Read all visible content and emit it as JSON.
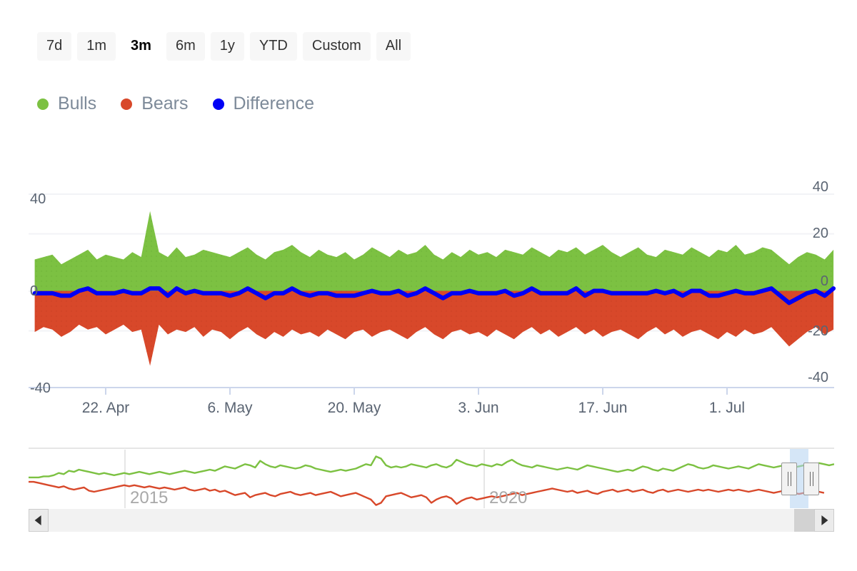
{
  "range_selector": {
    "buttons": [
      {
        "label": "7d",
        "selected": false
      },
      {
        "label": "1m",
        "selected": false
      },
      {
        "label": "3m",
        "selected": true
      },
      {
        "label": "6m",
        "selected": false
      },
      {
        "label": "1y",
        "selected": false
      },
      {
        "label": "YTD",
        "selected": false
      },
      {
        "label": "Custom",
        "selected": false
      },
      {
        "label": "All",
        "selected": false
      }
    ]
  },
  "legend": {
    "items": [
      {
        "label": "Bulls",
        "color": "#7cc142"
      },
      {
        "label": "Bears",
        "color": "#d8482a"
      },
      {
        "label": "Difference",
        "color": "#0000f5"
      }
    ]
  },
  "chart_data": {
    "type": "area",
    "title": "",
    "xlabel": "",
    "ylabel": "",
    "ylim": [
      -40,
      40
    ],
    "grid": true,
    "legend_position": "top-left",
    "y_ticks_left": [
      "40",
      "0",
      "-40"
    ],
    "y_ticks_right": [
      "40",
      "20",
      "0",
      "-20",
      "-40"
    ],
    "x_tick_labels": [
      "22. Apr",
      "6. May",
      "20. May",
      "3. Jun",
      "17. Jun",
      "1. Jul"
    ],
    "colors": {
      "bulls": "#7cc142",
      "bears": "#d8482a",
      "difference": "#0000f5",
      "gridline": "#f2f3f6",
      "axis": "#ccd6eb"
    },
    "series": [
      {
        "name": "Bulls",
        "type": "area",
        "values": [
          13,
          14,
          15,
          11,
          13,
          15,
          17,
          13,
          15,
          14,
          13,
          16,
          14,
          33,
          16,
          14,
          18,
          14,
          15,
          17,
          16,
          15,
          14,
          16,
          18,
          15,
          13,
          16,
          17,
          19,
          16,
          14,
          17,
          15,
          14,
          16,
          13,
          15,
          18,
          16,
          14,
          17,
          15,
          16,
          19,
          15,
          13,
          16,
          14,
          17,
          15,
          16,
          14,
          17,
          16,
          15,
          18,
          16,
          14,
          17,
          16,
          18,
          15,
          17,
          19,
          16,
          14,
          16,
          18,
          15,
          14,
          17,
          16,
          15,
          18,
          16,
          14,
          17,
          16,
          19,
          15,
          16,
          18,
          17,
          14,
          11,
          14,
          16,
          15,
          13,
          17
        ]
      },
      {
        "name": "Bears",
        "type": "area",
        "values": [
          -17,
          -15,
          -16,
          -19,
          -17,
          -14,
          -16,
          -15,
          -18,
          -16,
          -14,
          -17,
          -16,
          -31,
          -14,
          -18,
          -16,
          -17,
          -15,
          -19,
          -16,
          -17,
          -20,
          -17,
          -15,
          -18,
          -20,
          -17,
          -19,
          -16,
          -18,
          -17,
          -19,
          -16,
          -18,
          -20,
          -17,
          -16,
          -19,
          -17,
          -16,
          -18,
          -20,
          -17,
          -15,
          -18,
          -20,
          -17,
          -16,
          -18,
          -17,
          -19,
          -16,
          -18,
          -20,
          -17,
          -15,
          -18,
          -16,
          -19,
          -17,
          -15,
          -18,
          -16,
          -19,
          -17,
          -16,
          -18,
          -20,
          -17,
          -15,
          -18,
          -16,
          -19,
          -17,
          -16,
          -18,
          -20,
          -17,
          -19,
          -16,
          -18,
          -17,
          -15,
          -19,
          -23,
          -20,
          -17,
          -15,
          -18,
          -16
        ]
      },
      {
        "name": "Difference",
        "type": "line",
        "values": [
          -1,
          -1,
          -1,
          -2,
          -2,
          0,
          1,
          -1,
          -1,
          -1,
          0,
          -1,
          -1,
          1,
          1,
          -2,
          1,
          -1,
          0,
          -1,
          -1,
          -1,
          -2,
          -1,
          1,
          -1,
          -3,
          -1,
          -1,
          1,
          -1,
          -2,
          -1,
          -1,
          -2,
          -2,
          -2,
          -1,
          0,
          -1,
          -1,
          0,
          -2,
          -1,
          1,
          -1,
          -3,
          -1,
          -1,
          0,
          -1,
          -1,
          -1,
          0,
          -2,
          -1,
          1,
          -1,
          -1,
          -1,
          -1,
          1,
          -2,
          0,
          0,
          -1,
          -1,
          -1,
          -1,
          -1,
          0,
          -1,
          0,
          -2,
          0,
          0,
          -2,
          -2,
          -1,
          0,
          -1,
          -1,
          0,
          1,
          -2,
          -5,
          -3,
          -1,
          0,
          -2,
          1
        ]
      }
    ],
    "navigator": {
      "year_labels": [
        "2015",
        "2020"
      ],
      "selected_range_position": "far-right",
      "series": [
        {
          "name": "Bulls",
          "color": "#7cc142",
          "values": [
            2,
            2,
            2,
            3,
            3,
            4,
            6,
            5,
            8,
            7,
            9,
            8,
            7,
            6,
            5,
            6,
            5,
            4,
            5,
            6,
            5,
            6,
            7,
            6,
            5,
            6,
            7,
            6,
            5,
            6,
            7,
            8,
            7,
            6,
            7,
            8,
            9,
            8,
            10,
            12,
            11,
            10,
            12,
            14,
            13,
            11,
            17,
            14,
            12,
            11,
            13,
            12,
            11,
            10,
            11,
            13,
            12,
            10,
            9,
            8,
            7,
            8,
            9,
            8,
            9,
            10,
            12,
            14,
            13,
            21,
            19,
            13,
            11,
            12,
            11,
            12,
            14,
            13,
            12,
            11,
            13,
            14,
            12,
            11,
            13,
            18,
            16,
            14,
            13,
            12,
            14,
            13,
            12,
            14,
            13,
            16,
            18,
            15,
            13,
            12,
            11,
            13,
            12,
            11,
            10,
            9,
            10,
            11,
            10,
            9,
            11,
            13,
            12,
            11,
            10,
            9,
            8,
            7,
            8,
            9,
            8,
            10,
            12,
            11,
            9,
            8,
            10,
            9,
            8,
            10,
            12,
            14,
            13,
            11,
            10,
            11,
            13,
            12,
            11,
            10,
            11,
            12,
            11,
            10,
            12,
            14,
            13,
            12,
            11,
            12,
            13,
            12,
            11,
            12,
            13,
            14,
            13,
            15,
            14,
            13,
            14
          ]
        },
        {
          "name": "Bears",
          "color": "#d8482a",
          "values": [
            -2,
            -2,
            -3,
            -4,
            -5,
            -6,
            -7,
            -6,
            -8,
            -9,
            -8,
            -7,
            -10,
            -11,
            -10,
            -9,
            -8,
            -7,
            -6,
            -5,
            -6,
            -5,
            -6,
            -7,
            -6,
            -7,
            -8,
            -7,
            -8,
            -9,
            -8,
            -7,
            -9,
            -10,
            -9,
            -8,
            -10,
            -9,
            -11,
            -10,
            -12,
            -14,
            -13,
            -12,
            -16,
            -14,
            -13,
            -12,
            -14,
            -15,
            -13,
            -12,
            -11,
            -13,
            -14,
            -13,
            -12,
            -14,
            -13,
            -12,
            -11,
            -13,
            -15,
            -14,
            -13,
            -12,
            -14,
            -16,
            -18,
            -23,
            -21,
            -15,
            -14,
            -13,
            -12,
            -14,
            -16,
            -15,
            -14,
            -16,
            -21,
            -18,
            -16,
            -15,
            -17,
            -22,
            -19,
            -17,
            -16,
            -18,
            -17,
            -16,
            -15,
            -16,
            -15,
            -14,
            -13,
            -12,
            -14,
            -13,
            -12,
            -11,
            -10,
            -9,
            -8,
            -9,
            -10,
            -11,
            -10,
            -12,
            -11,
            -10,
            -12,
            -13,
            -11,
            -10,
            -9,
            -11,
            -10,
            -9,
            -11,
            -10,
            -9,
            -11,
            -12,
            -10,
            -9,
            -11,
            -10,
            -9,
            -10,
            -11,
            -10,
            -9,
            -10,
            -9,
            -10,
            -11,
            -10,
            -9,
            -10,
            -9,
            -10,
            -11,
            -10,
            -9,
            -10,
            -11,
            -12,
            -11,
            -10,
            -11,
            -12,
            -13,
            -12,
            -11,
            -10,
            -11,
            -12
          ]
        }
      ]
    }
  },
  "scrollbar": {
    "left_arrow": "scroll-left",
    "right_arrow": "scroll-right"
  }
}
